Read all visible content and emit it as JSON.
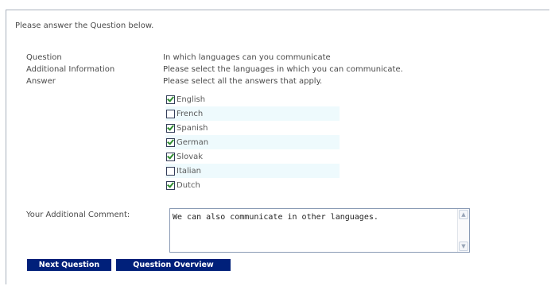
{
  "instruction": "Please answer the Question below.",
  "labels": {
    "question": "Question",
    "additional_information": "Additional Information",
    "answer": "Answer",
    "comment": "Your Additional Comment:"
  },
  "question_text": "In which languages can you communicate",
  "additional_information_text": "Please select the languages in which you can communicate.",
  "answer_instruction": "Please select all the answers that apply.",
  "options": [
    {
      "label": "English",
      "checked": true
    },
    {
      "label": "French",
      "checked": false
    },
    {
      "label": "Spanish",
      "checked": true
    },
    {
      "label": "German",
      "checked": true
    },
    {
      "label": "Slovak",
      "checked": true
    },
    {
      "label": "Italian",
      "checked": false
    },
    {
      "label": "Dutch",
      "checked": true
    }
  ],
  "comment_value": "We can also communicate in other languages.",
  "buttons": {
    "next": "Next Question",
    "overview": "Question Overview"
  },
  "colors": {
    "button_bg": "#00207a",
    "alt_row_bg": "#eefafd",
    "check": "#2f8c2f"
  }
}
